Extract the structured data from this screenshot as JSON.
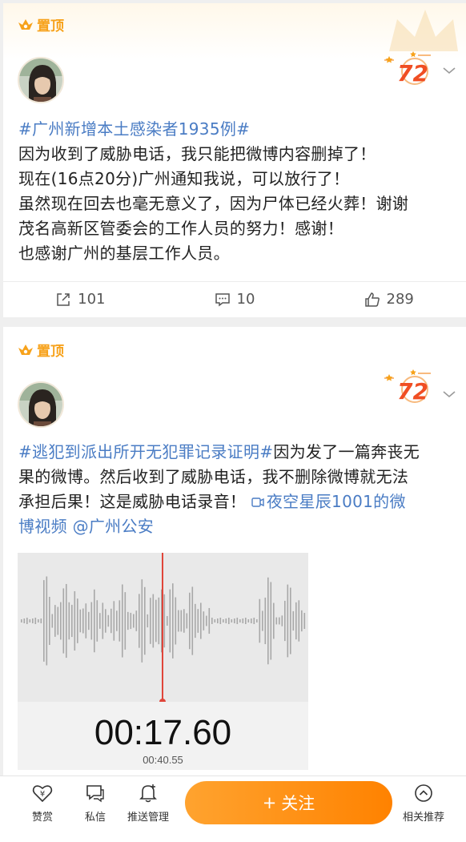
{
  "posts": [
    {
      "pin_label": "置顶",
      "lines": [
        "#广州新增本土感染者1935例#",
        "因为收到了威胁电话，我只能把微博内容删掉了！",
        "现在(16点20分)广州通知我说，可以放行了！",
        "虽然现在回去也毫无意义了，因为尸体已经火葬！谢谢",
        "茂名高新区管委会的工作人员的努力！感谢！",
        "也感谢广州的基层工作人员。"
      ],
      "reposts": "101",
      "comments": "10",
      "likes": "289"
    },
    {
      "pin_label": "置顶",
      "line1_hashtag": "#逃犯到派出所开无犯罪记录证明#",
      "line1_rest": "因为发了一篇奔丧无",
      "line2": "果的微博。然后收到了威胁电话，我不删除微博就无法",
      "line3_text": "承担后果！这是威胁电话录音！ ",
      "video_link": "夜空星辰1001的微",
      "line4_video": "博视频",
      "mention": "@广州公安",
      "recording": {
        "timer": "00:17.60",
        "duration": "00:40.55"
      }
    }
  ],
  "bottom_bar": {
    "reward": "赞赏",
    "message": "私信",
    "push": "推送管理",
    "follow": "关注",
    "follow_plus": "+",
    "related": "相关推荐"
  },
  "colors": {
    "accent": "#ff8200",
    "link": "#4a7cc4",
    "pin": "#f7a21b",
    "playhead": "#e0453a"
  }
}
